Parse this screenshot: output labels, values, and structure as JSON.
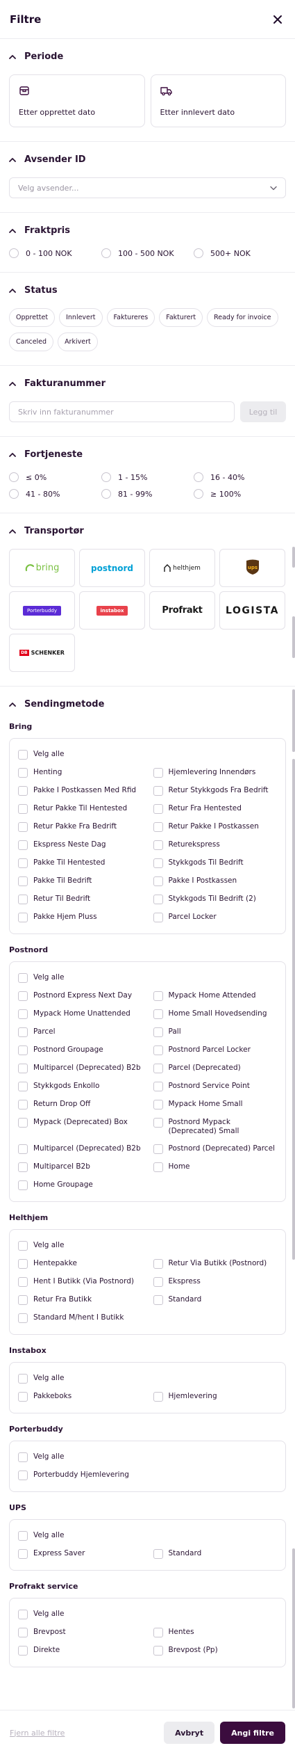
{
  "header": {
    "title": "Filtre",
    "close_icon": "close-icon"
  },
  "periode": {
    "title": "Periode",
    "cards": [
      {
        "label": "Etter opprettet dato",
        "icon": "package-icon"
      },
      {
        "label": "Etter innlevert dato",
        "icon": "delivery-truck-icon"
      }
    ]
  },
  "avsender": {
    "title": "Avsender ID",
    "placeholder": "Velg avsender..."
  },
  "fraktpris": {
    "title": "Fraktpris",
    "options": [
      "0 - 100 NOK",
      "100 - 500 NOK",
      "500+ NOK"
    ]
  },
  "status": {
    "title": "Status",
    "chips": [
      "Opprettet",
      "Innlevert",
      "Faktureres",
      "Fakturert",
      "Ready for invoice",
      "Canceled",
      "Arkivert"
    ]
  },
  "fakturanummer": {
    "title": "Fakturanummer",
    "placeholder": "Skriv inn fakturanummer",
    "add_label": "Legg til"
  },
  "fortjeneste": {
    "title": "Fortjeneste",
    "options": [
      "≤ 0%",
      "1 - 15%",
      "16 - 40%",
      "41 - 80%",
      "81 - 99%",
      "≥ 100%"
    ]
  },
  "transportor": {
    "title": "Transportør",
    "carriers": [
      {
        "name": "bring",
        "color": "#7bc144"
      },
      {
        "name": "postnord",
        "color": "#00a0d6"
      },
      {
        "name": "helthjem",
        "color": "#1a1a1a"
      },
      {
        "name": "ups",
        "color": "#7a4a1e"
      },
      {
        "name": "Porterbuddy",
        "color": "#5b2bd6"
      },
      {
        "name": "instabox",
        "color": "#e8424b"
      },
      {
        "name": "Profrakt",
        "color": "#1a1a1a"
      },
      {
        "name": "LOGISTA",
        "color": "#1a1a1a"
      },
      {
        "name": "SCHENKER",
        "color": "#e2001a"
      }
    ]
  },
  "sendingmetode": {
    "title": "Sendingmetode",
    "groups": [
      {
        "name": "Bring",
        "select_all": "Velg alle",
        "items": [
          "Henting",
          "Hjemlevering Innendørs",
          "Pakke I Postkassen Med Rfid",
          "Retur Stykkgods Fra Bedrift",
          "Retur Pakke Til Hentested",
          "Retur Fra Hentested",
          "Retur Pakke Fra Bedrift",
          "Retur Pakke I Postkassen",
          "Ekspress Neste Dag",
          "Returekspress",
          "Pakke Til Hentested",
          "Stykkgods Til Bedrift",
          "Pakke Til Bedrift",
          "Pakke I Postkassen",
          "Retur Til Bedrift",
          "Stykkgods Til Bedrift (2)",
          "Pakke Hjem Pluss",
          "Parcel Locker"
        ]
      },
      {
        "name": "Postnord",
        "select_all": "Velg alle",
        "items": [
          "Postnord Express Next Day",
          "Mypack Home Attended",
          "Mypack Home Unattended",
          "Home Small Hovedsending",
          "Parcel",
          "Pall",
          "Postnord Groupage",
          "Postnord Parcel Locker",
          "Multiparcel (Deprecated) B2b",
          "Parcel (Deprecated)",
          "Stykkgods Enkollo",
          "Postnord Service Point",
          "Return Drop Off",
          "Mypack Home Small",
          "Mypack (Deprecated) Box",
          "Postnord Mypack (Deprecated) Small",
          "Multiparcel (Deprecated) B2b",
          "Postnord (Deprecated) Parcel",
          "Multiparcel B2b",
          "Home",
          "Home Groupage"
        ]
      },
      {
        "name": "Helthjem",
        "select_all": "Velg alle",
        "items": [
          "Hentepakke",
          "Retur Via Butikk (Postnord)",
          "Hent I Butikk (Via Postnord)",
          "Ekspress",
          "Retur Fra Butikk",
          "Standard",
          "Standard M/hent I Butikk"
        ]
      },
      {
        "name": "Instabox",
        "select_all": "Velg alle",
        "items": [
          "Pakkeboks",
          "Hjemlevering"
        ]
      },
      {
        "name": "Porterbuddy",
        "select_all": "Velg alle",
        "items": [
          "Porterbuddy Hjemlevering"
        ]
      },
      {
        "name": "UPS",
        "select_all": "Velg alle",
        "items": [
          "Express Saver",
          "Standard"
        ]
      },
      {
        "name": "Profrakt service",
        "select_all": "Velg alle",
        "items": [
          "Brevpost",
          "Hentes",
          "Direkte",
          "Brevpost (Pp)"
        ]
      }
    ]
  },
  "footer": {
    "clear_label": "Fjern alle filtre",
    "cancel_label": "Avbryt",
    "apply_label": "Angi filtre"
  }
}
